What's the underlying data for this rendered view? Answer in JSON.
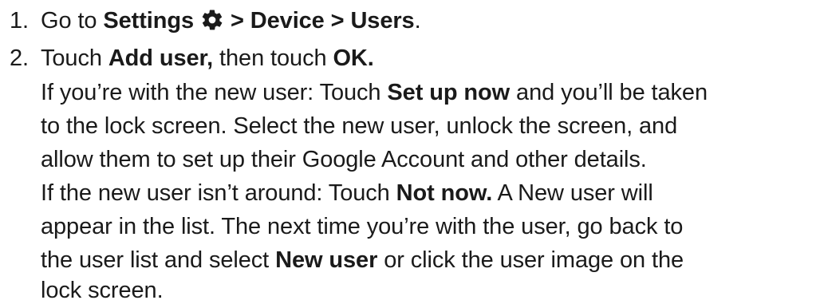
{
  "steps": [
    {
      "number": "1.",
      "prefix": "Go to ",
      "settings": "Settings",
      "path": "> Device > Users",
      "end": "."
    },
    {
      "number": "2.",
      "prefix": "Touch ",
      "add_user": "Add user,",
      "mid": " then touch ",
      "ok": "OK."
    }
  ],
  "para1": {
    "l1_a": "If you’re with the new user: Touch ",
    "l1_b": "Set up now",
    "l1_c": " and you’ll be taken",
    "l2": "to the lock screen. Select the new user, unlock the screen, and",
    "l3": "allow them to set up their Google Account and other details."
  },
  "para2": {
    "l1_a": "If the new user isn’t around: Touch ",
    "l1_b": "Not now.",
    "l1_c": " A New user will",
    "l2": "appear in the list. The next time you’re with the user, go back to",
    "l3_a": "the user list and select ",
    "l3_b": "New user",
    "l3_c": " or click the user image on the",
    "l4": "lock screen."
  },
  "icons": {
    "settings": "gear-icon"
  }
}
